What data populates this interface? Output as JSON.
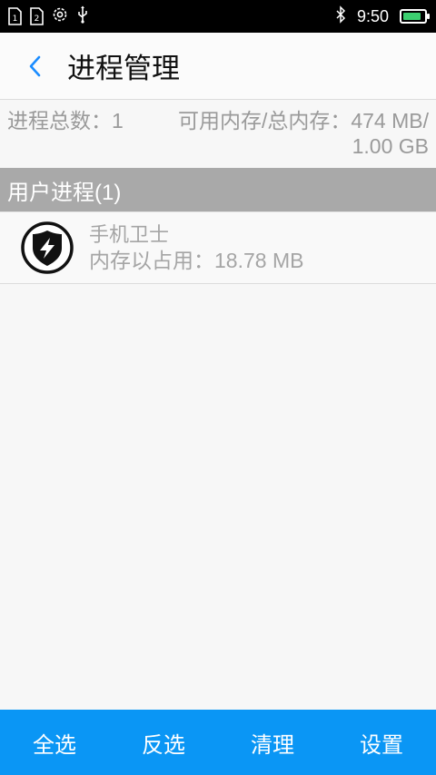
{
  "status_bar": {
    "sim1": "1",
    "sim2": "2",
    "time": "9:50",
    "battery_level": 0.9,
    "battery_color": "#3cd070"
  },
  "header": {
    "title": "进程管理",
    "back_icon": "chevron-left-icon",
    "back_color": "#1a8cff"
  },
  "summary": {
    "process_count": "进程总数：1",
    "memory": "可用内存/总内存：474 MB/ 1.00 GB"
  },
  "section": {
    "title": "用户进程(1)"
  },
  "processes": [
    {
      "name": "手机卫士",
      "memory": "内存以占用：18.78 MB",
      "icon": "shield-bolt-icon"
    }
  ],
  "bottom_bar": {
    "select_all": "全选",
    "invert": "反选",
    "clean": "清理",
    "settings": "设置",
    "color": "#0a96f5"
  }
}
